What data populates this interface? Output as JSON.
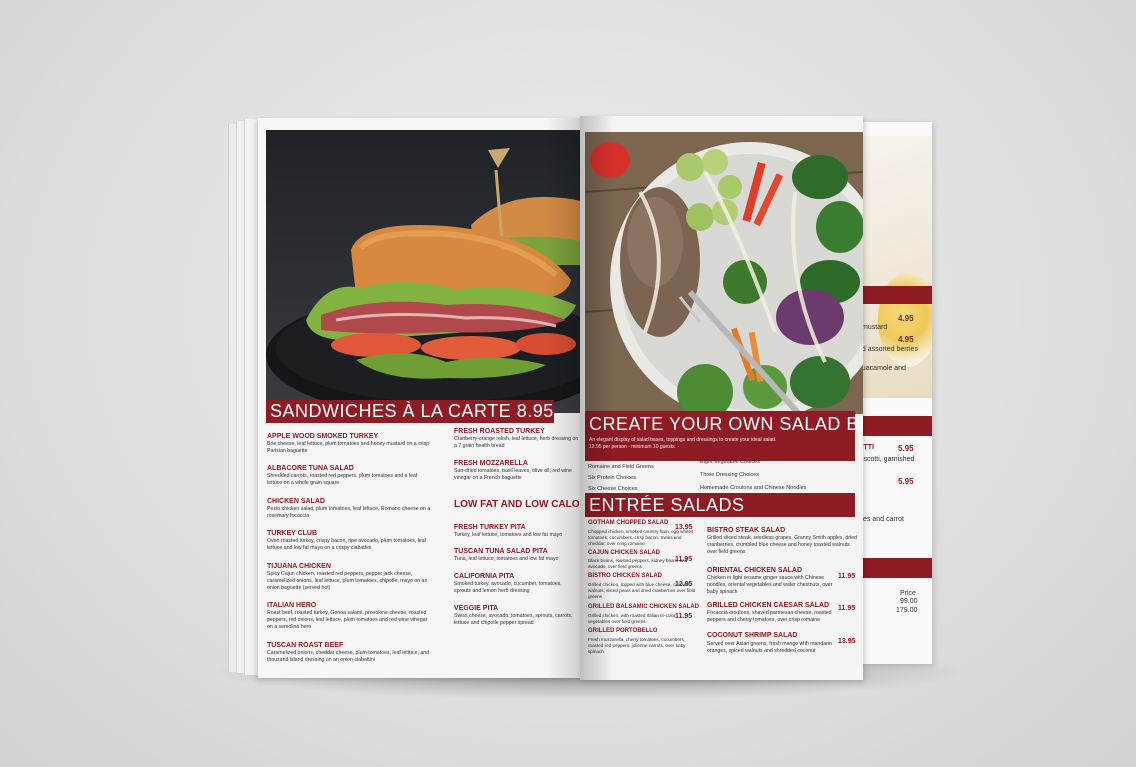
{
  "left_page": {
    "banner": "SANDWICHES À LA CARTE  8.95",
    "col1": [
      {
        "name": "APPLE WOOD SMOKED TURKEY",
        "desc": "Brie cheese, leaf lettuce, plum tomatoes and honey mustard on a crisp Parisian baguette"
      },
      {
        "name": "ALBACORE TUNA SALAD",
        "desc": "Shredded carrots, roasted red peppers, plum tomatoes and a leaf lettuce on a whole grain square"
      },
      {
        "name": "CHICKEN SALAD",
        "desc": "Pesto chicken salad, plum tomatoes, leaf lettuce, Romano cheese on a rosemary focaccia"
      },
      {
        "name": "TURKEY CLUB",
        "desc": "Oven roasted turkey, crispy bacon, ripe avocado, plum tomatoes, leaf lettuce and low fat mayo on a crispy ciabattini"
      },
      {
        "name": "TIJUANA CHICKEN",
        "desc": "Spicy Cajun chicken, roasted red peppers, pepper jack cheese, caramelized onions, leaf lettuce, plum tomatoes, chipotle, mayo on an onion baguette (served hot)"
      },
      {
        "name": "ITALIAN HERO",
        "desc": "Roast beef, roasted turkey, Genoa salami, provolone cheese, roasted peppers, red onions, leaf lettuce, plum tomatoes and red wine vinegar on a semolina hero"
      },
      {
        "name": "TUSCAN ROAST BEEF",
        "desc": "Caramelized onions, cheddar cheese, plum tomatoes, leaf lettuce, and thousand island dressing on an onion ciabattini"
      }
    ],
    "col2": [
      {
        "name": "FRESH ROASTED TURKEY",
        "desc": "Cranberry-orange relish, leaf lettuce, herb dressing on a 7 grain health bread"
      },
      {
        "name": "FRESH MOZZARELLA",
        "desc": "Sun-dried tomatoes, basil leaves, olive oil, red wine vinegar on a French baguette"
      }
    ],
    "low_fat_heading": "LOW FAT AND LOW CALORIE PITA",
    "col2_pita": [
      {
        "name": "FRESH TURKEY PITA",
        "desc": "Turkey, leaf lettuce, tomatoes and low fat mayo"
      },
      {
        "name": "TUSCAN TUNA SALAD PITA",
        "desc": "Tuna, leaf lettuce, tomatoes and low fat mayo"
      },
      {
        "name": "CALIFORNIA PITA",
        "desc": "Smoked turkey, avocado, cucumber, tomatoes, sprouts and lemon herb dressing"
      },
      {
        "name": "VEGGIE PITA",
        "desc": "Swiss cheese, avocado, tomatoes, sprouts, carrots, lettuce and chipotle pepper spread"
      }
    ]
  },
  "right_page": {
    "banner": "CREATE YOUR OWN SALAD BAR",
    "banner_desc": "An elegant display of salad bases, toppings and dressings to create your ideal salad. 12.95 per person - minimum 10 guests",
    "bullets_left": [
      "Romaine and Field Greens",
      "Six Protein Choices",
      "Six Cheese Choices"
    ],
    "bullets_right": [
      "Eight Vegetable Choices",
      "Three Dressing Choices",
      "Homemade Croutons and Chinese Noodles"
    ],
    "entree_heading": "ENTRÉE SALADS",
    "col1": [
      {
        "name": "GOTHAM CHOPPED SALAD",
        "price": "13.95",
        "desc": "Chopped chicken, smoked country ham, egg whites, tomatoes, cucumbers, crisp bacon, Swiss and cheddar, over crisp romaine"
      },
      {
        "name": "CAJUN CHICKEN SALAD",
        "price": "11.95",
        "desc": "Black beans, roasted peppers, kidney beans and avocado, over field greens"
      },
      {
        "name": "BISTRO CHICKEN SALAD",
        "price": "12.95",
        "desc": "Grilled chicken, topped with blue cheese, candied walnuts, sliced pears and dried cranberries over field greens"
      },
      {
        "name": "GRILLED BALSAMIC CHICKEN SALAD",
        "price": "11.95",
        "desc": "Grilled chicken, with roasted Italian tri-color vegetables over field greens"
      },
      {
        "name": "GRILLED PORTOBELLO",
        "price": "",
        "desc": "Fresh mozzarella, cherry tomatoes, cucumbers, roasted red peppers, julienne carrots, over baby spinach"
      }
    ],
    "col2": [
      {
        "name": "BISTRO STEAK SALAD",
        "price": "",
        "desc": "Grilled sliced steak, seedless grapes, Granny Smith apples, dried cranberries, crumbled blue cheese and honey toasted walnuts over field greens"
      },
      {
        "name": "ORIENTAL CHICKEN SALAD",
        "price": "11.95",
        "desc": "Chicken in light sesame ginger sauce with Chinese noodles, oriental vegetables and water chestnuts, over baby spinach"
      },
      {
        "name": "GRILLED CHICKEN CAESAR SALAD",
        "price": "11.95",
        "desc": "Focaccia croutons, shaved parmesan cheese, roasted peppers and cherry tomatoes, over crisp romaine"
      },
      {
        "name": "COCONUT SHRIMP SALAD",
        "price": "13.95",
        "desc": "Served over Asian greens, fresh mango with mandarin oranges, spiced walnuts and shredded coconut"
      }
    ]
  },
  "back_page": {
    "texts": [
      "mustard",
      "nd assorted berries",
      "guacamole and",
      "OTTI",
      "biscotti, garnished",
      "kles and carrot",
      "Price"
    ],
    "prices": [
      "4.95",
      "4.95",
      "5.95",
      "5.95"
    ],
    "plain_prices": [
      "99.00",
      "179.00"
    ]
  },
  "colors": {
    "accent": "#8f1b25",
    "page": "#f6f6f6",
    "background": "#dcdcdc"
  }
}
